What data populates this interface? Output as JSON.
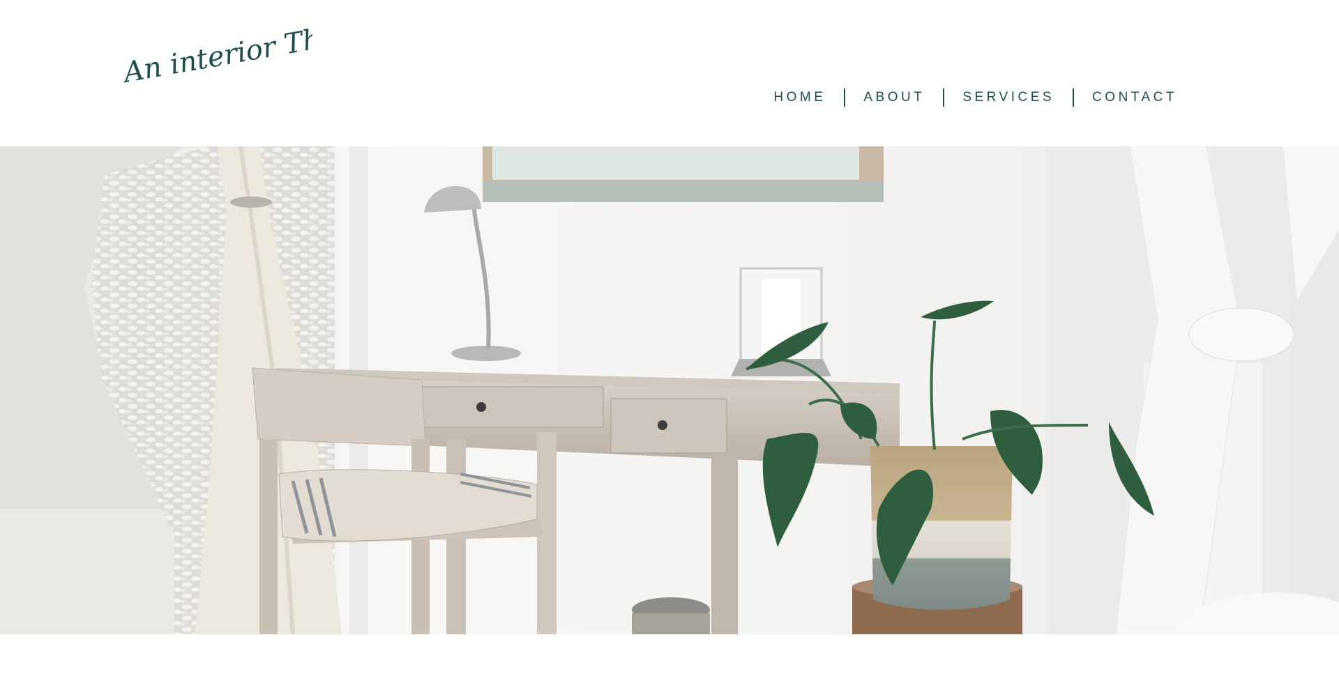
{
  "brand": {
    "logo_text": "An interior Thing",
    "color": "#1d4d4f"
  },
  "nav": {
    "items": [
      {
        "label": "HOME"
      },
      {
        "label": "ABOUT"
      },
      {
        "label": "SERVICES"
      },
      {
        "label": "CONTACT"
      }
    ]
  },
  "hero": {
    "description_icon": "interior-photo",
    "palette": {
      "wall": "#f4f3f1",
      "wood": "#c9c1b6",
      "leaf": "#2f5e3f",
      "curtain": "#efebe4"
    }
  }
}
